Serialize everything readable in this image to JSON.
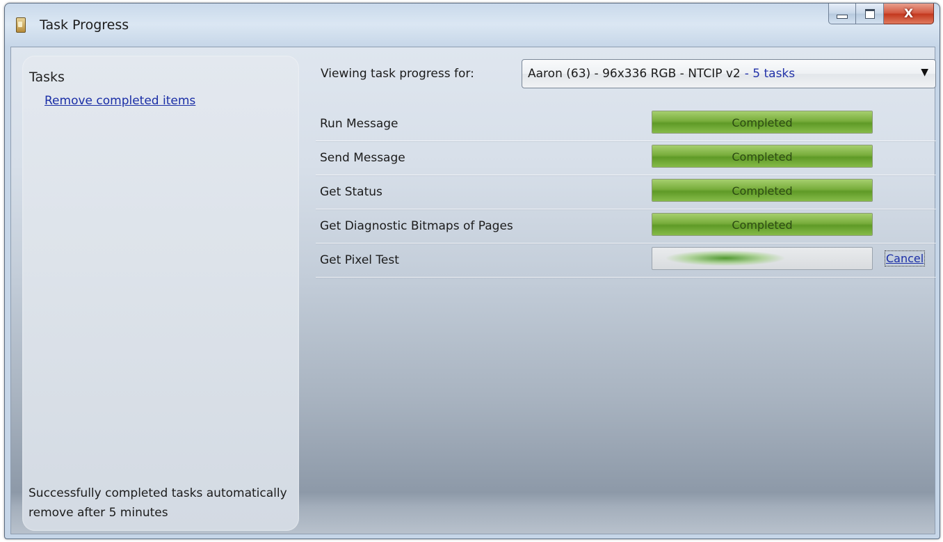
{
  "window": {
    "title": "Task Progress",
    "controls": {
      "close_glyph": "X"
    }
  },
  "sidebar": {
    "heading": "Tasks",
    "remove_link": "Remove completed items",
    "footer_note": "Successfully completed tasks automatically remove after 5 minutes"
  },
  "main": {
    "viewing_label": "Viewing task progress for:",
    "device_select": {
      "value": "Aaron (63) - 96x336 RGB - NTCIP v2",
      "count": "- 5 tasks"
    },
    "tasks": [
      {
        "name": "Run Message",
        "status": "Completed",
        "progress": 1.0
      },
      {
        "name": "Send Message",
        "status": "Completed",
        "progress": 1.0
      },
      {
        "name": "Get Status",
        "status": "Completed",
        "progress": 1.0
      },
      {
        "name": "Get Diagnostic Bitmaps of Pages",
        "status": "Completed",
        "progress": 1.0
      },
      {
        "name": "Get Pixel Test",
        "status": "",
        "progress": null,
        "cancel_label": "Cancel"
      }
    ]
  },
  "colors": {
    "progress_green": "#78ad3c",
    "link_blue": "#1a2ea6",
    "close_red": "#c2361c"
  },
  "icons": [
    "app-icon",
    "minimize-icon",
    "maximize-icon",
    "close-icon",
    "dropdown-arrow-icon"
  ]
}
